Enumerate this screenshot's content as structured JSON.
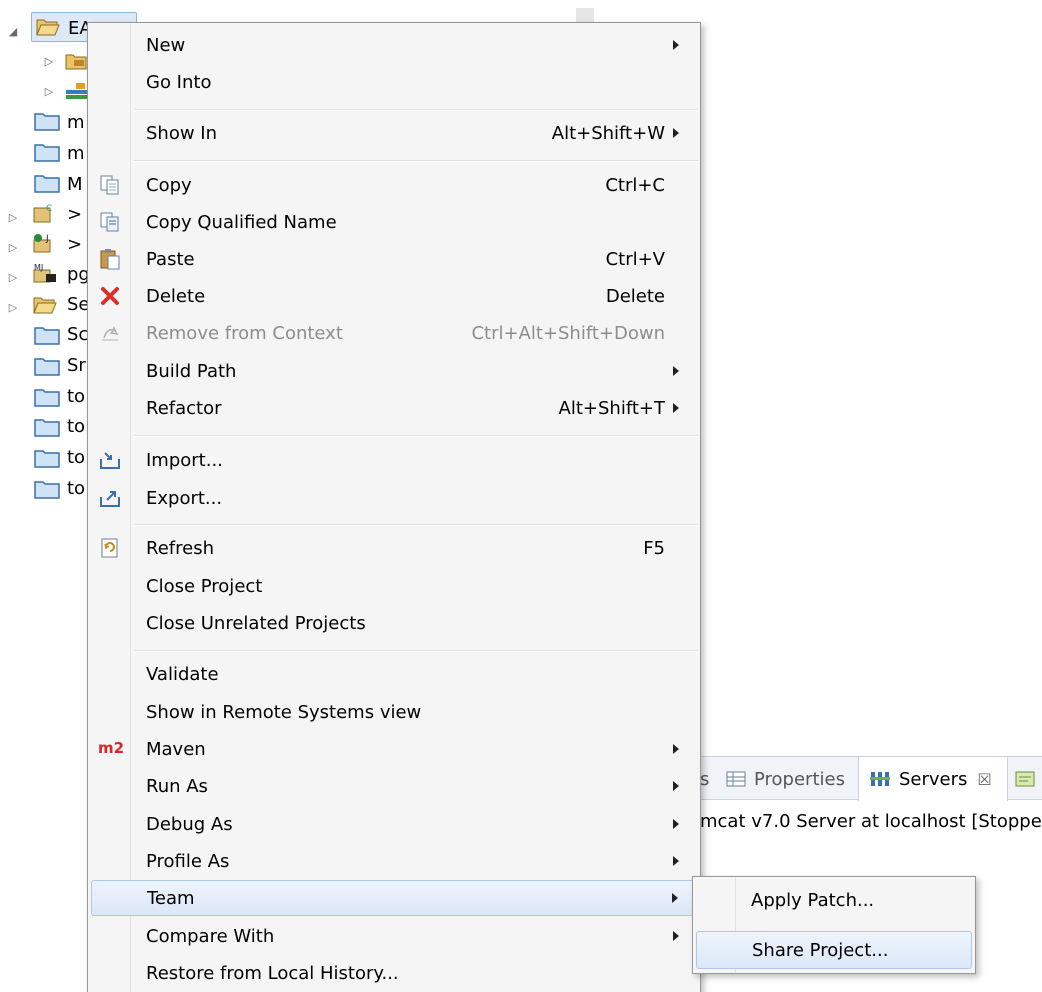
{
  "tree": {
    "root_label": "EA",
    "items": [
      {
        "label": "",
        "kind": "package-folder"
      },
      {
        "label": "",
        "kind": "library"
      },
      {
        "label": "m",
        "kind": "folder"
      },
      {
        "label": "m",
        "kind": "folder"
      },
      {
        "label": "M",
        "kind": "folder"
      },
      {
        "label": ">",
        "kind": "project-c"
      },
      {
        "label": ">",
        "kind": "project-j"
      },
      {
        "label": "pg",
        "kind": "project-m"
      },
      {
        "label": "Se",
        "kind": "folder-open"
      },
      {
        "label": "Sc",
        "kind": "folder"
      },
      {
        "label": "Sr",
        "kind": "folder"
      },
      {
        "label": "to",
        "kind": "folder"
      },
      {
        "label": "to",
        "kind": "folder"
      },
      {
        "label": "to",
        "kind": "folder"
      },
      {
        "label": "to",
        "kind": "folder"
      }
    ]
  },
  "menu": {
    "items": [
      {
        "label": "New",
        "accel": "",
        "submenu": true
      },
      {
        "label": "Go Into",
        "accel": ""
      },
      {
        "label": "Show In",
        "accel": "Alt+Shift+W",
        "submenu": true
      },
      {
        "label": "Copy",
        "accel": "Ctrl+C",
        "icon": "copy-icon"
      },
      {
        "label": "Copy Qualified Name",
        "accel": "",
        "icon": "copy-qualified-name-icon"
      },
      {
        "label": "Paste",
        "accel": "Ctrl+V",
        "icon": "paste-icon"
      },
      {
        "label": "Delete",
        "accel": "Delete",
        "icon": "delete-icon"
      },
      {
        "label": "Remove from Context",
        "accel": "Ctrl+Alt+Shift+Down",
        "icon": "remove-context-icon",
        "disabled": true
      },
      {
        "label": "Build Path",
        "accel": "",
        "submenu": true
      },
      {
        "label": "Refactor",
        "accel": "Alt+Shift+T",
        "submenu": true
      },
      {
        "label": "Import...",
        "accel": "",
        "icon": "import-icon"
      },
      {
        "label": "Export...",
        "accel": "",
        "icon": "export-icon"
      },
      {
        "label": "Refresh",
        "accel": "F5",
        "icon": "refresh-icon"
      },
      {
        "label": "Close Project",
        "accel": ""
      },
      {
        "label": "Close Unrelated Projects",
        "accel": ""
      },
      {
        "label": "Validate",
        "accel": ""
      },
      {
        "label": "Show in Remote Systems view",
        "accel": ""
      },
      {
        "label": "Maven",
        "accel": "",
        "submenu": true,
        "icon": "maven-icon",
        "icon_text": "m2"
      },
      {
        "label": "Run As",
        "accel": "",
        "submenu": true
      },
      {
        "label": "Debug As",
        "accel": "",
        "submenu": true
      },
      {
        "label": "Profile As",
        "accel": "",
        "submenu": true
      },
      {
        "label": "Team",
        "accel": "",
        "submenu": true,
        "highlighted": true
      },
      {
        "label": "Compare With",
        "accel": "",
        "submenu": true
      },
      {
        "label": "Restore from Local History...",
        "accel": ""
      }
    ]
  },
  "submenu": {
    "items": [
      {
        "label": "Apply Patch..."
      },
      {
        "label": "Share Project...",
        "highlighted": true
      }
    ]
  },
  "views": {
    "tabs": [
      {
        "label": "s"
      },
      {
        "label": "Properties"
      },
      {
        "label": "Servers",
        "close": "☒"
      }
    ],
    "server_line": "mcat v7.0 Server at localhost  [Stoppe"
  },
  "colors": {
    "menu_bg": "#f5f5f5",
    "highlight_border": "#aac8ec",
    "maven_red": "#d6262b",
    "delete_red": "#d9302c",
    "folder_blue": "#3b6fa8"
  }
}
